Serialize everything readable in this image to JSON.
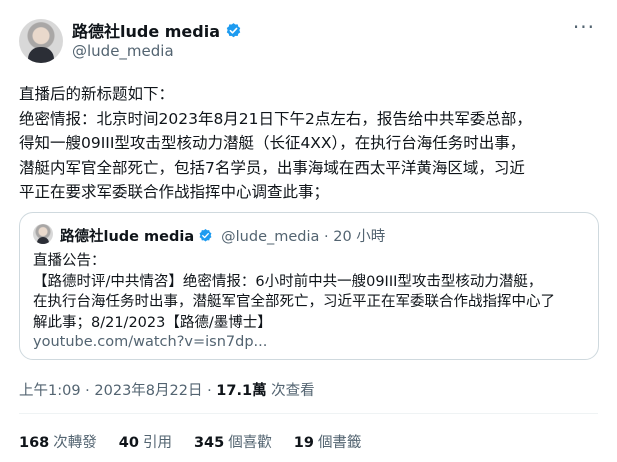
{
  "author": {
    "display_name": "路德社lude media",
    "handle": "@lude_media",
    "verified_color": "#1d9bf0"
  },
  "tweet": {
    "text": "直播后的新标题如下：\n绝密情报：北京时间2023年8月21日下午2点左右，报告给中共军委总部，\n得知一艘09III型攻击型核动力潜艇（长征4XX），在执行台海任务时出事，\n潜艇内军官全部死亡，包括7名学员，出事海域在西太平洋黄海区域，习近\n平正在要求军委联合作战指挥中心调查此事；"
  },
  "quote": {
    "display_name": "路德社lude media",
    "meta": "@lude_media · 20 小時",
    "text": "直播公告：\n【路德时评/中共情咨】绝密情报：6小时前中共一艘09III型攻击型核动力潜艇，\n在执行台海任务时出事，潜艇军官全部死亡，习近平正在军委联合作战指挥中心了\n解此事；8/21/2023【路德/墨博士】",
    "link": "youtube.com/watch?v=isn7dp..."
  },
  "timestamp": {
    "time": "上午1:09 · 2023年8月22日 · ",
    "views": "17.1萬",
    "views_label": " 次查看"
  },
  "stats": [
    {
      "num": "168",
      "label": "次轉發"
    },
    {
      "num": "40",
      "label": "引用"
    },
    {
      "num": "345",
      "label": "個喜歡"
    },
    {
      "num": "19",
      "label": "個書籤"
    }
  ],
  "icons": {
    "more": "more-dots-icon",
    "verified": "verified-badge-icon"
  }
}
